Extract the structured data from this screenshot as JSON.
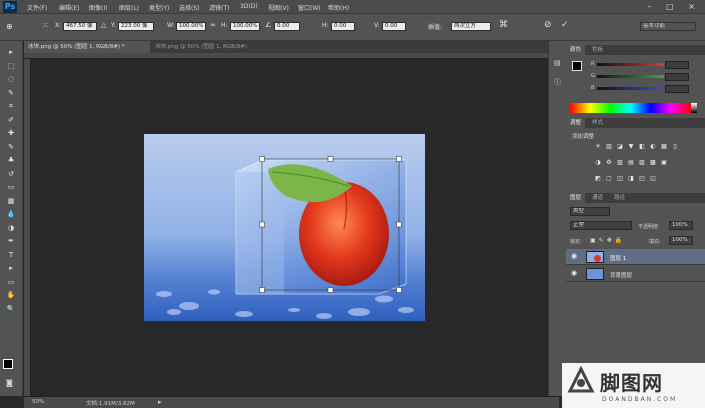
{
  "app": {
    "logo": "Ps"
  },
  "menu": [
    "文件(F)",
    "编辑(E)",
    "图像(I)",
    "图层(L)",
    "类型(Y)",
    "选择(S)",
    "滤镜(T)",
    "3D(D)",
    "视图(V)",
    "窗口(W)",
    "帮助(H)"
  ],
  "window_controls": "– □ ×",
  "options": {
    "x_label": "X:",
    "x_value": "467.50 像",
    "y_label": "Y:",
    "y_value": "223.00 像",
    "w_label": "W:",
    "w_value": "100.00%",
    "h_label": "H:",
    "h_value": "100.00%",
    "angle_value": "0.00",
    "hskew_label": "H:",
    "hskew_value": "0.00",
    "vskew_label": "V:",
    "vskew_value": "0.00",
    "interp_label": "插值:",
    "interp_value": "两次立方",
    "workspace_value": "基本功能"
  },
  "tabs": [
    {
      "label": "冰块.png @ 50% (图层 1, RGB/8#) *",
      "active": true
    },
    {
      "label": "冰块.png @ 50% (图层 1, RGB/8#)",
      "active": false
    }
  ],
  "tool_icons": [
    "move-icon",
    "marquee-icon",
    "lasso-icon",
    "quick-select-icon",
    "crop-icon",
    "eyedropper-icon",
    "healing-icon",
    "brush-icon",
    "stamp-icon",
    "history-brush-icon",
    "eraser-icon",
    "gradient-icon",
    "blur-icon",
    "dodge-icon",
    "pen-icon",
    "type-icon",
    "path-select-icon",
    "shape-icon",
    "hand-icon",
    "zoom-icon"
  ],
  "tool_glyphs": [
    "▸",
    "⬚",
    "◌",
    "✎",
    "⌗",
    "✐",
    "✚",
    "✎",
    "♣",
    "↺",
    "▭",
    "▦",
    "💧",
    "◑",
    "✒",
    "T",
    "▸",
    "▭",
    "✋",
    "🔍"
  ],
  "status": {
    "zoom": "50%",
    "doc": "文档:1.91M/3.82M"
  },
  "panels": {
    "color": {
      "tabs": [
        "颜色",
        "色板"
      ],
      "labels": [
        "R",
        "G",
        "B"
      ],
      "colors": [
        "#d23a3a",
        "#3aa83a",
        "#3a4ed2"
      ]
    },
    "adjust": {
      "tabs": [
        "调整",
        "样式"
      ],
      "title": "添加调整"
    },
    "layers": {
      "tabs": [
        "图层",
        "通道",
        "路径"
      ],
      "filter": "类型",
      "blend": "正常",
      "opacity_label": "不透明度:",
      "opacity_value": "100%",
      "lock_label": "锁定:",
      "fill_label": "填充:",
      "fill_value": "100%",
      "items": [
        {
          "name": "图层 1",
          "selected": true
        },
        {
          "name": "背景图层",
          "selected": false
        }
      ]
    }
  },
  "watermark": {
    "text": "脚图网",
    "sub": "DOANDBAN.COM"
  }
}
